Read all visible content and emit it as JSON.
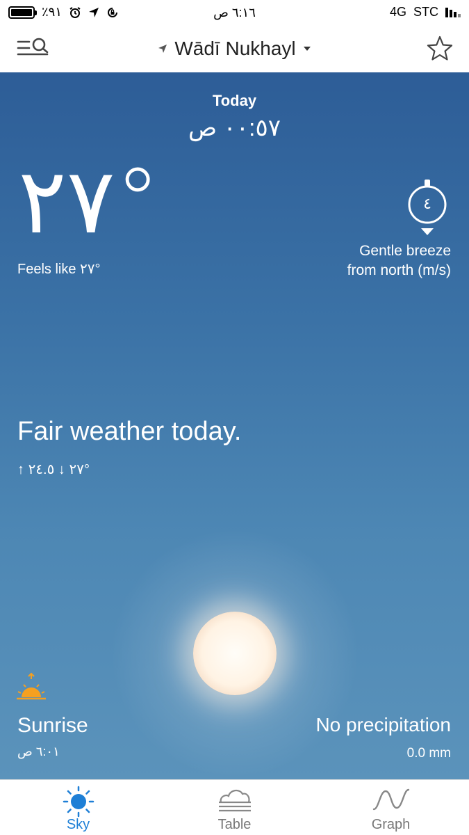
{
  "status_bar": {
    "battery_percent": "٪٩١",
    "time": "٦:١٦ ص",
    "network": "4G",
    "carrier": "STC"
  },
  "nav": {
    "location": "Wādī Nukhayl"
  },
  "hero": {
    "day_label": "Today",
    "time": "٠٠:٥٧ ص",
    "temperature": "٢٧°",
    "feels_like": "Feels like ٢٧°",
    "wind_speed": "٤",
    "wind_line1": "Gentle breeze",
    "wind_line2": "from north (m/s)",
    "summary": "Fair weather today.",
    "max_temp": "٢٧",
    "min_temp": "٢٤.٥°",
    "sunrise_label": "Sunrise",
    "sunrise_time": "٦:٠١ ص",
    "precip_label": "No precipitation",
    "precip_value": "0.0 mm"
  },
  "tabs": [
    {
      "label": "Sky",
      "active": true
    },
    {
      "label": "Table",
      "active": false
    },
    {
      "label": "Graph",
      "active": false
    }
  ],
  "colors": {
    "accent": "#1e7fd6",
    "sky_top": "#2d5d97",
    "sky_bottom": "#5b93bb",
    "sunrise_icon": "#f5a020"
  },
  "icons": {
    "menu": "menu-search-icon",
    "location": "location-arrow-icon",
    "favorite": "star-icon",
    "wind": "wind-direction-icon",
    "sunrise": "sunrise-icon",
    "sky_tab": "sun-icon",
    "table_tab": "cloud-table-icon",
    "graph_tab": "graph-wave-icon"
  }
}
